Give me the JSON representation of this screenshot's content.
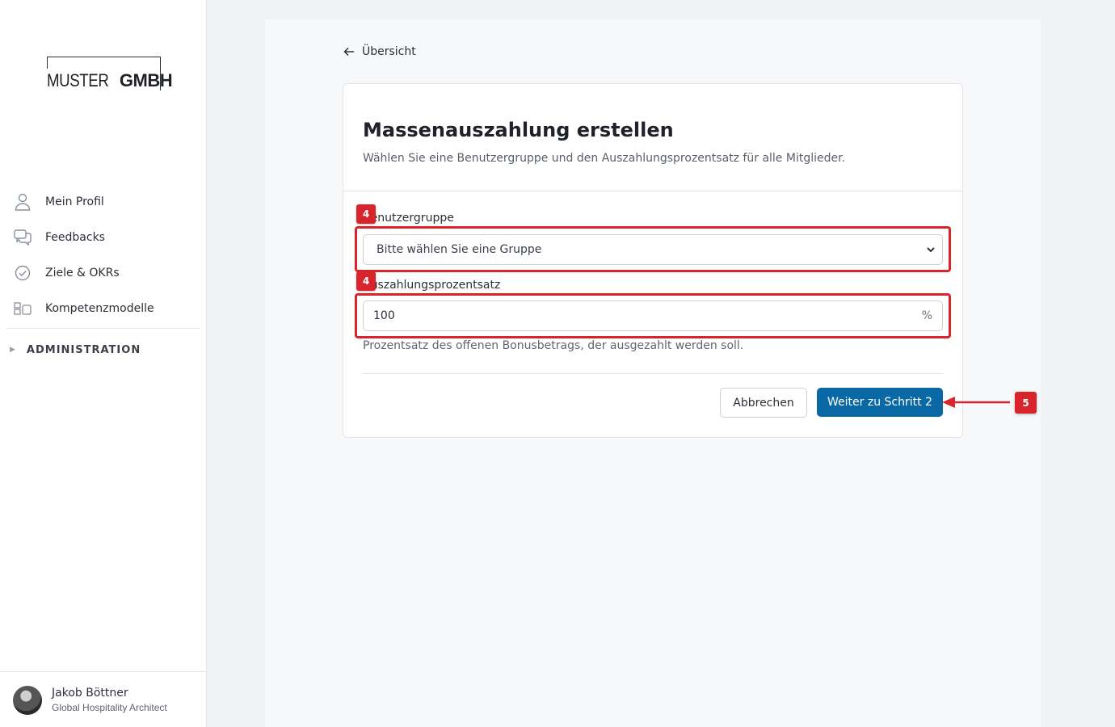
{
  "logo": {
    "part1": "MUSTER",
    "part2": "GMBH"
  },
  "sidebar": {
    "items": [
      {
        "label": "Mein Profil",
        "icon": "user-icon"
      },
      {
        "label": "Feedbacks",
        "icon": "chat-bubbles-icon"
      },
      {
        "label": "Ziele & OKRs",
        "icon": "check-circle-icon"
      },
      {
        "label": "Kompetenzmodelle",
        "icon": "modules-icon"
      }
    ],
    "admin_label": "ADMINISTRATION"
  },
  "user": {
    "name": "Jakob Böttner",
    "role": "Global Hospitality Architect"
  },
  "back": {
    "label": "Übersicht"
  },
  "card": {
    "title": "Massenauszahlung erstellen",
    "subtitle": "Wählen Sie eine Benutzergruppe und den Auszahlungsprozentsatz für alle Mitglieder."
  },
  "form": {
    "group_label": "Benutzergruppe",
    "group_placeholder": "Bitte wählen Sie eine Gruppe",
    "percent_label": "Auszahlungsprozentsatz",
    "percent_value": "100",
    "percent_suffix": "%",
    "percent_help": "Prozentsatz des offenen Bonusbetrags, der ausgezahlt werden soll."
  },
  "buttons": {
    "cancel": "Abbrechen",
    "next": "Weiter zu Schritt 2"
  },
  "annotations": {
    "badge_group": "4",
    "badge_percent": "4",
    "badge_next": "5",
    "color": "#d8242b"
  },
  "colors": {
    "primary": "#0a68a4",
    "annotation": "#d8242b"
  }
}
